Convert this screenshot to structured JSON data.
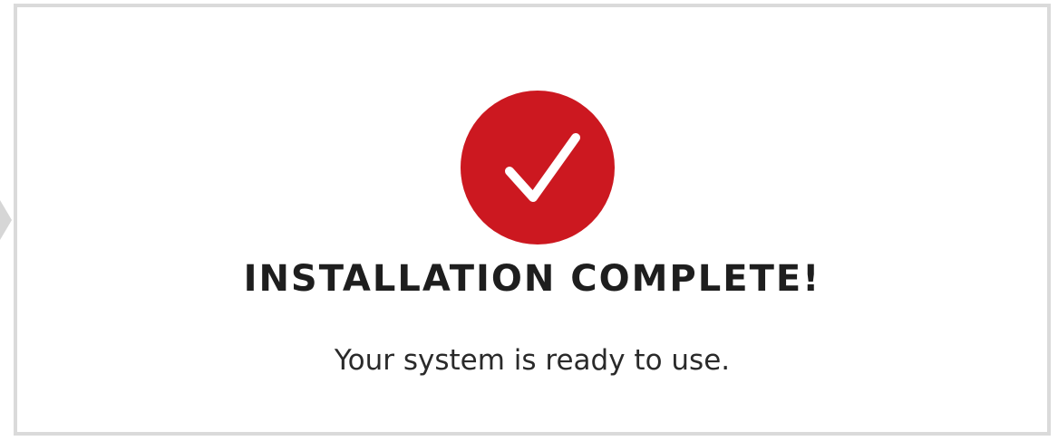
{
  "status": {
    "icon": "checkmark-circle-icon",
    "title": "INSTALLATION COMPLETE!",
    "message": "Your system is ready to use."
  },
  "colors": {
    "accent": "#cc1820",
    "panel_border": "#dadada",
    "connector": "#d6d6d6",
    "title_text": "#1e1e1e",
    "message_text": "#2a2a2a"
  }
}
